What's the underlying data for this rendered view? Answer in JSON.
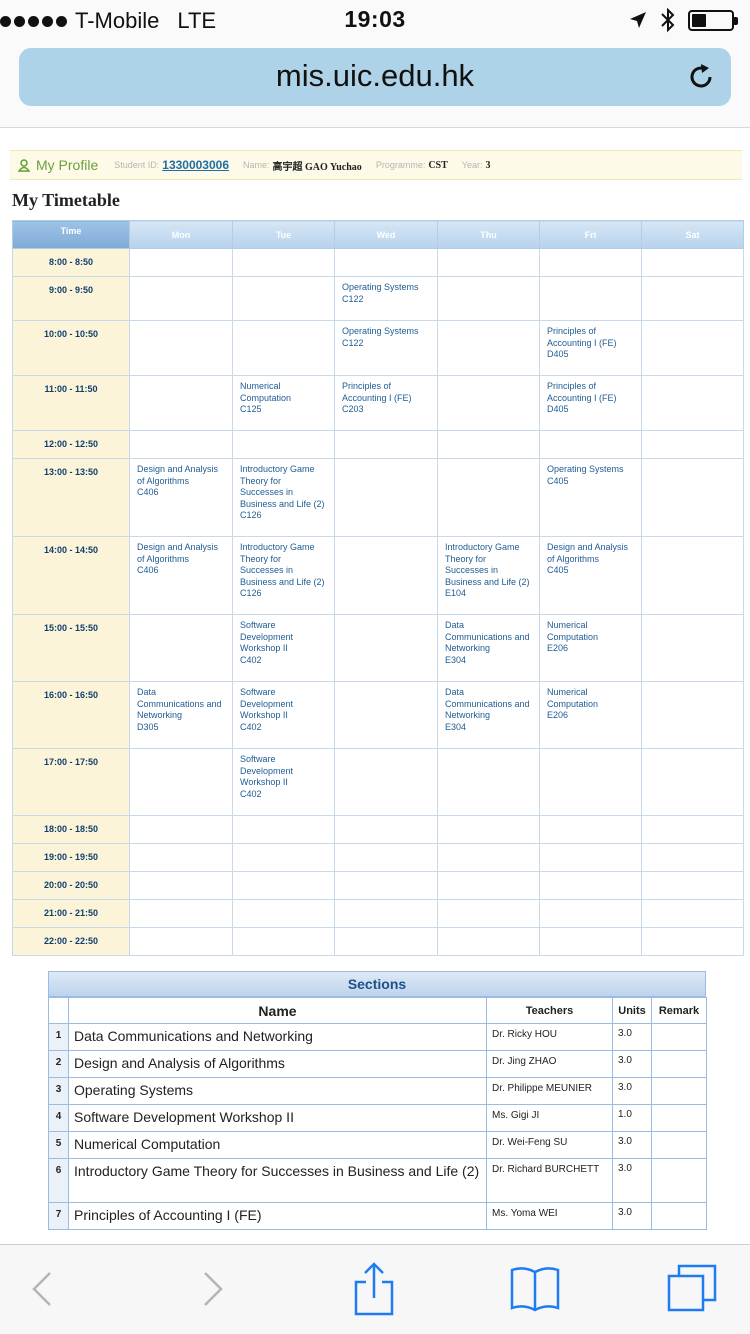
{
  "status_bar": {
    "carrier": "T-Mobile",
    "network": "LTE",
    "time": "19:03"
  },
  "browser": {
    "url": "mis.uic.edu.hk"
  },
  "profile": {
    "link_label": "My Profile",
    "student_id_label": "Student ID:",
    "student_id": "1330003006",
    "name_label": "Name:",
    "name": "高宇超 GAO Yuchao",
    "programme_label": "Programme:",
    "programme": "CST",
    "year_label": "Year:",
    "year": "3"
  },
  "page_title": "My Timetable",
  "timetable": {
    "headers": [
      "Time",
      "Mon",
      "Tue",
      "Wed",
      "Thu",
      "Fri",
      "Sat"
    ],
    "rows": [
      {
        "time": "8:00 - 8:50",
        "cells": [
          [],
          [],
          [],
          [],
          [],
          []
        ]
      },
      {
        "time": "9:00 - 9:50",
        "cells": [
          [],
          [],
          [
            "Operating Systems",
            "C122"
          ],
          [],
          [],
          []
        ]
      },
      {
        "time": "10:00 - 10:50",
        "cells": [
          [],
          [],
          [
            "Operating Systems",
            "C122"
          ],
          [],
          [
            "Principles of",
            "Accounting I (FE)",
            "D405"
          ],
          []
        ]
      },
      {
        "time": "11:00 - 11:50",
        "cells": [
          [],
          [
            "Numerical",
            "Computation",
            "C125"
          ],
          [
            "Principles of",
            "Accounting I (FE)",
            "C203"
          ],
          [],
          [
            "Principles of",
            "Accounting I (FE)",
            "D405"
          ],
          []
        ]
      },
      {
        "time": "12:00 - 12:50",
        "cells": [
          [],
          [],
          [],
          [],
          [],
          []
        ]
      },
      {
        "time": "13:00 - 13:50",
        "cells": [
          [
            "Design and Analysis",
            "of Algorithms",
            "C406"
          ],
          [
            "Introductory Game",
            "Theory for",
            "Successes in",
            "Business and Life (2)",
            "C126"
          ],
          [],
          [],
          [
            "Operating Systems",
            "C405"
          ],
          []
        ]
      },
      {
        "time": "14:00 - 14:50",
        "cells": [
          [
            "Design and Analysis",
            "of Algorithms",
            "C406"
          ],
          [
            "Introductory Game",
            "Theory for",
            "Successes in",
            "Business and Life (2)",
            "C126"
          ],
          [],
          [
            "Introductory Game",
            "Theory for",
            "Successes in",
            "Business and Life (2)",
            "E104"
          ],
          [
            "Design and Analysis",
            "of Algorithms",
            "C405"
          ],
          []
        ]
      },
      {
        "time": "15:00 - 15:50",
        "cells": [
          [],
          [
            "Software",
            "Development",
            "Workshop II",
            "C402"
          ],
          [],
          [
            "Data",
            "Communications and",
            "Networking",
            "E304"
          ],
          [
            "Numerical",
            "Computation",
            "E206"
          ],
          []
        ]
      },
      {
        "time": "16:00 - 16:50",
        "cells": [
          [
            "Data",
            "Communications and",
            "Networking",
            "D305"
          ],
          [
            "Software",
            "Development",
            "Workshop II",
            "C402"
          ],
          [],
          [
            "Data",
            "Communications and",
            "Networking",
            "E304"
          ],
          [
            "Numerical",
            "Computation",
            "E206"
          ],
          []
        ]
      },
      {
        "time": "17:00 - 17:50",
        "cells": [
          [],
          [
            "Software",
            "Development",
            "Workshop II",
            "C402"
          ],
          [],
          [],
          [],
          []
        ]
      },
      {
        "time": "18:00 - 18:50",
        "cells": [
          [],
          [],
          [],
          [],
          [],
          []
        ]
      },
      {
        "time": "19:00 - 19:50",
        "cells": [
          [],
          [],
          [],
          [],
          [],
          []
        ]
      },
      {
        "time": "20:00 - 20:50",
        "cells": [
          [],
          [],
          [],
          [],
          [],
          []
        ]
      },
      {
        "time": "21:00 - 21:50",
        "cells": [
          [],
          [],
          [],
          [],
          [],
          []
        ]
      },
      {
        "time": "22:00 - 22:50",
        "cells": [
          [],
          [],
          [],
          [],
          [],
          []
        ]
      }
    ]
  },
  "sections": {
    "title": "Sections",
    "headers": {
      "name": "Name",
      "teachers": "Teachers",
      "units": "Units",
      "remark": "Remark"
    },
    "rows": [
      {
        "num": "1",
        "name": "Data Communications and Networking",
        "teacher": "Dr. Ricky HOU",
        "units": "3.0",
        "remark": ""
      },
      {
        "num": "2",
        "name": "Design and Analysis of Algorithms",
        "teacher": "Dr. Jing ZHAO",
        "units": "3.0",
        "remark": ""
      },
      {
        "num": "3",
        "name": "Operating Systems",
        "teacher": "Dr. Philippe MEUNIER",
        "units": "3.0",
        "remark": ""
      },
      {
        "num": "4",
        "name": "Software Development Workshop II",
        "teacher": "Ms. Gigi JI",
        "units": "1.0",
        "remark": ""
      },
      {
        "num": "5",
        "name": "Numerical Computation",
        "teacher": "Dr. Wei-Feng SU",
        "units": "3.0",
        "remark": ""
      },
      {
        "num": "6",
        "name": "Introductory Game Theory for Successes in Business and Life (2)",
        "teacher": "Dr. Richard BURCHETT",
        "units": "3.0",
        "remark": ""
      },
      {
        "num": "7",
        "name": "Principles of Accounting I (FE)",
        "teacher": "Ms. Yoma WEI",
        "units": "3.0",
        "remark": ""
      }
    ]
  },
  "toolbar": {
    "icons": [
      "back-icon",
      "forward-icon",
      "share-icon",
      "bookmarks-icon",
      "tabs-icon"
    ]
  }
}
